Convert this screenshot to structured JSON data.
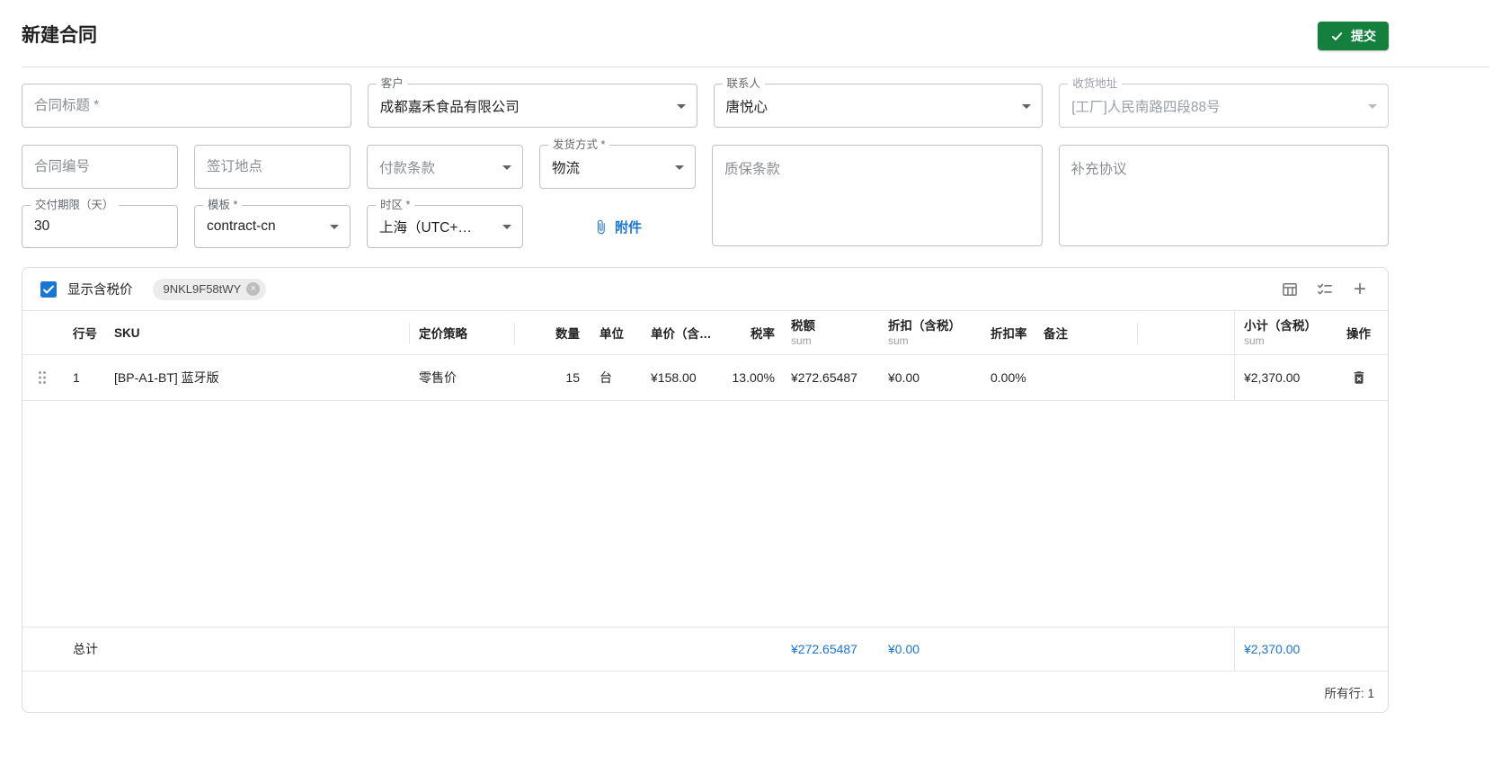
{
  "page": {
    "title": "新建合同",
    "submit_label": "提交"
  },
  "icons": {
    "close": "×",
    "add": "+"
  },
  "colors": {
    "primary_blue": "#1976d2",
    "submit_green": "#15803d"
  },
  "form": {
    "contract_title": {
      "placeholder": "合同标题 *",
      "value": ""
    },
    "customer": {
      "label": "客户",
      "value": "成都嘉禾食品有限公司"
    },
    "contact": {
      "label": "联系人",
      "value": "唐悦心"
    },
    "shipping_address": {
      "label": "收货地址",
      "value": "[工厂]人民南路四段88号"
    },
    "contract_no": {
      "placeholder": "合同编号",
      "value": ""
    },
    "signing_place": {
      "placeholder": "签订地点",
      "value": ""
    },
    "payment_terms": {
      "placeholder": "付款条款",
      "value": ""
    },
    "shipping_method": {
      "label": "发货方式 *",
      "value": "物流"
    },
    "warranty": {
      "placeholder": "质保条款",
      "value": ""
    },
    "supplement": {
      "placeholder": "补充协议",
      "value": ""
    },
    "delivery_days": {
      "label": "交付期限（天）",
      "value": "30"
    },
    "template": {
      "label": "模板 *",
      "value": "contract-cn"
    },
    "timezone": {
      "label": "时区 *",
      "value": "上海（UTC+…"
    },
    "attachment": {
      "label": "附件"
    }
  },
  "table": {
    "show_tax_label": "显示含税价",
    "tag": "9NKL9F58tWY",
    "headers": {
      "line_no": "行号",
      "sku": "SKU",
      "pricing": "定价策略",
      "qty": "数量",
      "unit": "单位",
      "unit_price": "单价（含…",
      "tax_rate": "税率",
      "tax_amount": "税额",
      "discount": "折扣（含税）",
      "discount_rate": "折扣率",
      "note": "备注",
      "subtotal": "小计（含税）",
      "actions": "操作",
      "sum_label": "sum"
    },
    "rows": [
      {
        "line_no": "1",
        "sku": "[BP-A1-BT] 蓝牙版",
        "pricing": "零售价",
        "qty": "15",
        "unit": "台",
        "unit_price": "¥158.00",
        "tax_rate": "13.00%",
        "tax_amount": "¥272.65487",
        "discount": "¥0.00",
        "discount_rate": "0.00%",
        "note": "",
        "subtotal": "¥2,370.00"
      }
    ],
    "total": {
      "label": "总计",
      "tax_amount": "¥272.65487",
      "discount": "¥0.00",
      "subtotal": "¥2,370.00"
    },
    "footer": "所有行: 1"
  }
}
